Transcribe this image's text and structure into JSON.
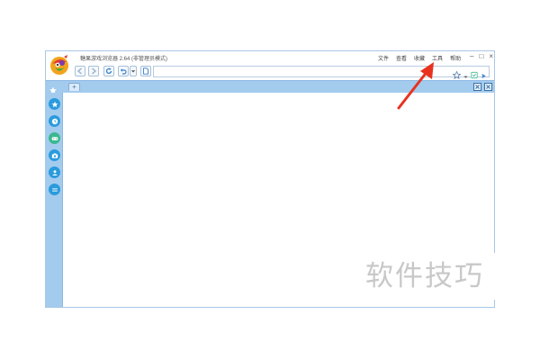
{
  "window": {
    "title": "糖果游戏浏览器 2.64 (非管理员模式)",
    "menu": [
      "文件",
      "查看",
      "收藏",
      "工具",
      "帮助"
    ],
    "controls": {
      "minimize": "–",
      "maximize": "□",
      "close": "×"
    }
  },
  "toolbar": {
    "icons": [
      "back-icon",
      "forward-icon",
      "refresh-icon",
      "undo-icon",
      "dropdown-icon",
      "new-page-icon"
    ],
    "address_value": "",
    "address_icons": [
      "star-icon",
      "dropdown-icon",
      "security-icon",
      "go-icon"
    ]
  },
  "tabbar": {
    "new_tab_label": "+"
  },
  "sidebar": {
    "icons": [
      "star-icon",
      "clock-icon",
      "gamepad-icon",
      "camera-icon",
      "user-icon",
      "menu-icon"
    ]
  },
  "overlay": {
    "watermark": "软件技巧",
    "annotation": "red-arrow-pointing-to-tools-menu"
  },
  "colors": {
    "frame_blue": "#a3cbee",
    "sidebar_green": "#3bb88f",
    "sidebar_blue": "#2a9bdd",
    "arrow_red": "#e8321f"
  }
}
